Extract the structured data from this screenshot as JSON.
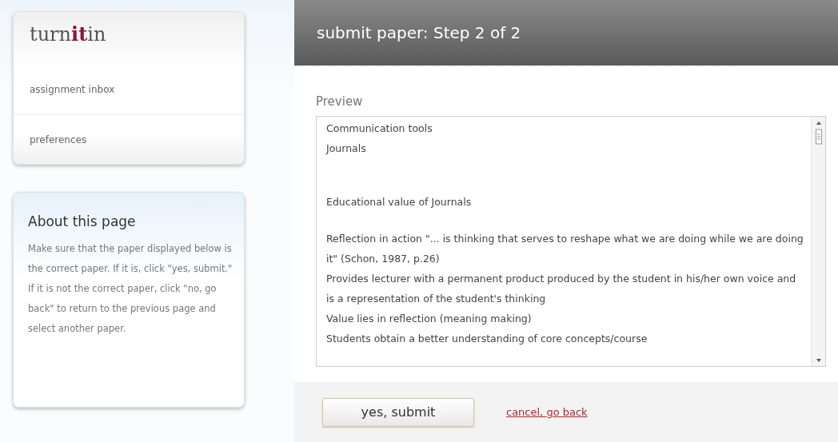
{
  "sidebar": {
    "logo": "turn**it**in",
    "items": [
      {
        "label": "assignment inbox"
      },
      {
        "label": "preferences"
      }
    ]
  },
  "about": {
    "title": "About this page",
    "text": "Make sure that the paper displayed below is the correct paper. If it is, click \"yes, submit.\" If it is not the correct paper, click \"no, go back\" to return to the previous page and select another paper."
  },
  "header": {
    "title": "submit paper: Step 2 of 2"
  },
  "preview": {
    "label": "Preview",
    "paragraphs": [
      {
        "text": "Communication tools"
      },
      {
        "text": "Journals"
      },
      {
        "kind": "gap"
      },
      {
        "text": "Educational value of Journals"
      },
      {
        "kind": "space"
      },
      {
        "text": "Reflection in action \"... is thinking that serves to reshape what we are doing while we are doing it\" (Schon, 1987, p.26)"
      },
      {
        "text": "Provides lecturer with a permanent product produced by the student in his/her own voice and is a representation of the student's thinking"
      },
      {
        "text": "Value lies in reflection (meaning making)"
      },
      {
        "text": "Students obtain a better understanding of core concepts/course"
      }
    ]
  },
  "actions": {
    "submit": "yes, submit",
    "cancel": "cancel, go back"
  }
}
